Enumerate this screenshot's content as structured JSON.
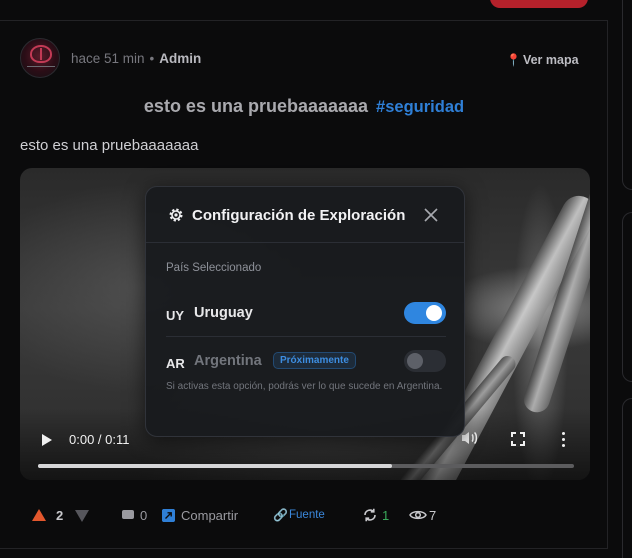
{
  "post": {
    "time_ago": "hace 51 min",
    "separator": "•",
    "author": "Admin",
    "map_link": "Ver mapa",
    "title": "esto es una pruebaaaaaaa",
    "hashtag": "#seguridad",
    "body": "esto es una pruebaaaaaaa"
  },
  "video": {
    "current_time": "0:00",
    "duration": "0:11",
    "time_display": "0:00 / 0:11",
    "progress_fraction": 0.66
  },
  "modal": {
    "title": "Configuración de Exploración",
    "section_label": "País Seleccionado",
    "countries": [
      {
        "code": "UY",
        "name": "Uruguay",
        "enabled": true
      },
      {
        "code": "AR",
        "name": "Argentina",
        "badge": "Próximamente",
        "enabled": false
      }
    ],
    "hint": "Si activas esta opción, podrás ver lo que sucede en Argentina."
  },
  "actions": {
    "votes": "2",
    "comments": "0",
    "share_label": "Compartir",
    "source_label": "Fuente",
    "reposts": "1",
    "views": "7"
  },
  "colors": {
    "accent_blue": "#2f86e0",
    "upvote": "#e3572d",
    "repost": "#3aa85a",
    "top_button": "#b5212b"
  },
  "icons": [
    "map-pin-icon",
    "gear-icon",
    "close-icon",
    "play-icon",
    "volume-icon",
    "fullscreen-icon",
    "more-vertical-icon",
    "upvote-icon",
    "downvote-icon",
    "comment-icon",
    "share-icon",
    "link-icon",
    "repost-icon",
    "eye-icon"
  ]
}
